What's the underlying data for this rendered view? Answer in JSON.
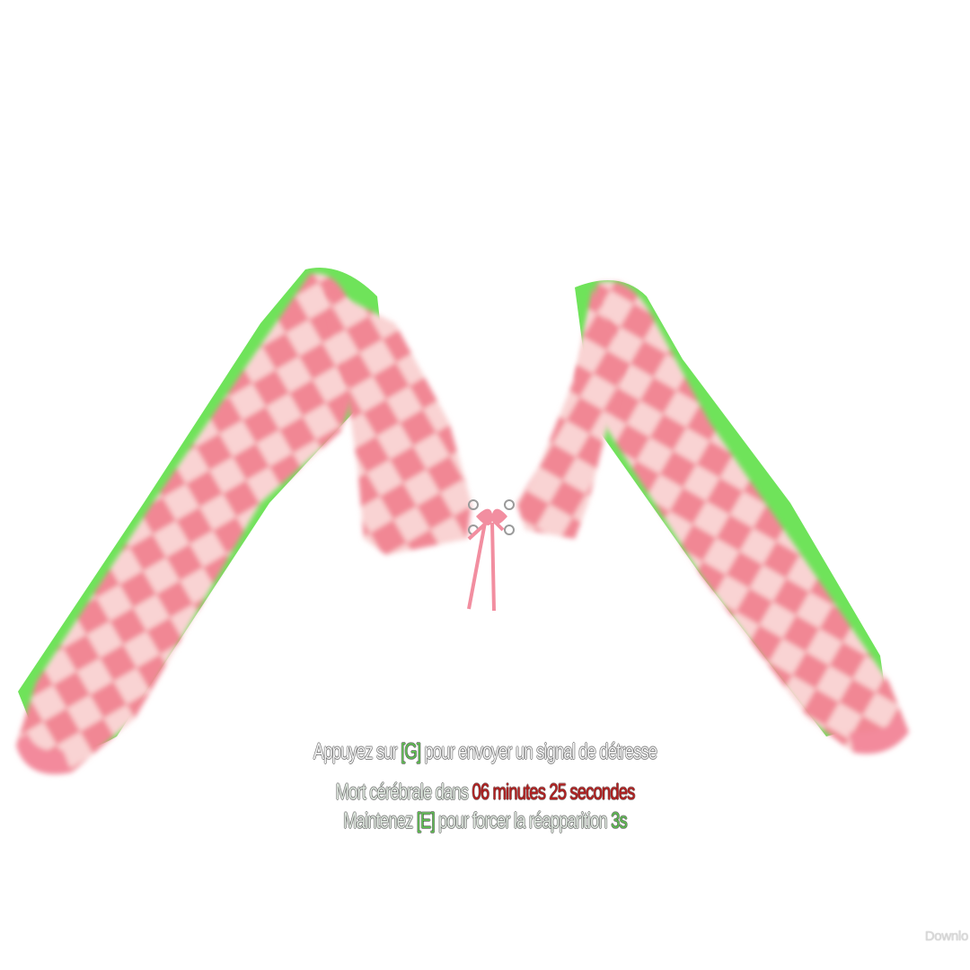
{
  "hud": {
    "distress": {
      "prefix": "Appuyez sur ",
      "key": "[G]",
      "suffix": " pour envoyer un signal de détresse"
    },
    "brain_death": {
      "prefix": "Mort cérébrale dans ",
      "time": "06 minutes 25 secondes"
    },
    "respawn": {
      "prefix": "Maintenez ",
      "key": "[E]",
      "middle": " pour forcer la réapparition ",
      "countdown": "3s"
    }
  },
  "footer": {
    "download_label": "Downlo"
  },
  "colors": {
    "garment_base": "#f9d3d3",
    "garment_checks": "#f07a8a",
    "garment_outline": "#6fe35a",
    "key_highlight": "#5fbf52",
    "danger_text": "#b51f1f"
  }
}
